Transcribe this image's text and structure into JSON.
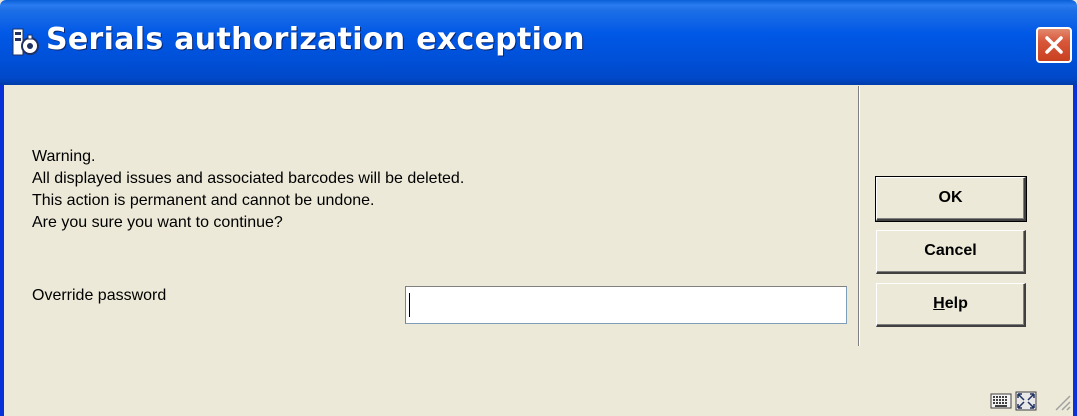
{
  "window": {
    "title": "Serials authorization exception"
  },
  "message": {
    "lines": [
      "Warning.",
      "All displayed issues and associated barcodes will be deleted.",
      "This action is permanent and cannot be undone.",
      "Are you sure you want to continue?"
    ]
  },
  "password": {
    "label": "Override password",
    "value": ""
  },
  "buttons": {
    "ok": "OK",
    "cancel": "Cancel",
    "help_first": "H",
    "help_rest": "elp"
  },
  "colors": {
    "titlebar": "#0058e6",
    "dialog_bg": "#ece9d8",
    "close_button": "#d8563a"
  },
  "icons": {
    "app": "library-app-icon",
    "close": "close-icon",
    "status_keyboard": "keyboard-icon",
    "status_expand": "expand-icon",
    "resize": "resize-grip-icon"
  }
}
